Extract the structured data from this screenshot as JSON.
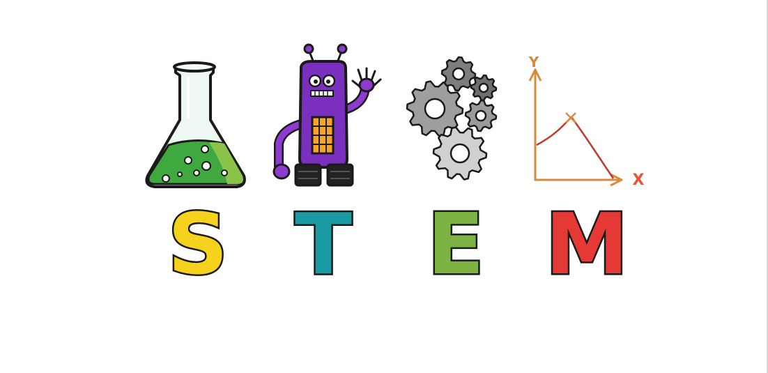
{
  "image": {
    "description_free": true,
    "background_color": "#ffffff"
  },
  "icons": {
    "science": "flask-icon",
    "technology": "robot-icon",
    "engineering": "gears-icon",
    "math": "graph-icon"
  },
  "letters": {
    "s": "S",
    "t": "T",
    "e": "E",
    "m": "M"
  },
  "graph_axes": {
    "y": "Y",
    "x": "X"
  },
  "colors": {
    "s": "#f5d31c",
    "t": "#1c9aa3",
    "e": "#7cb342",
    "m": "#e53935",
    "flask_liquid": "#4caf50",
    "robot": "#7b2fbe",
    "gear_dark": "#8c8c8c",
    "gear_light": "#cfcfcf",
    "graph_axis": "#d98a3a",
    "graph_line": "#c0392b",
    "outline": "#1a1a1a"
  }
}
